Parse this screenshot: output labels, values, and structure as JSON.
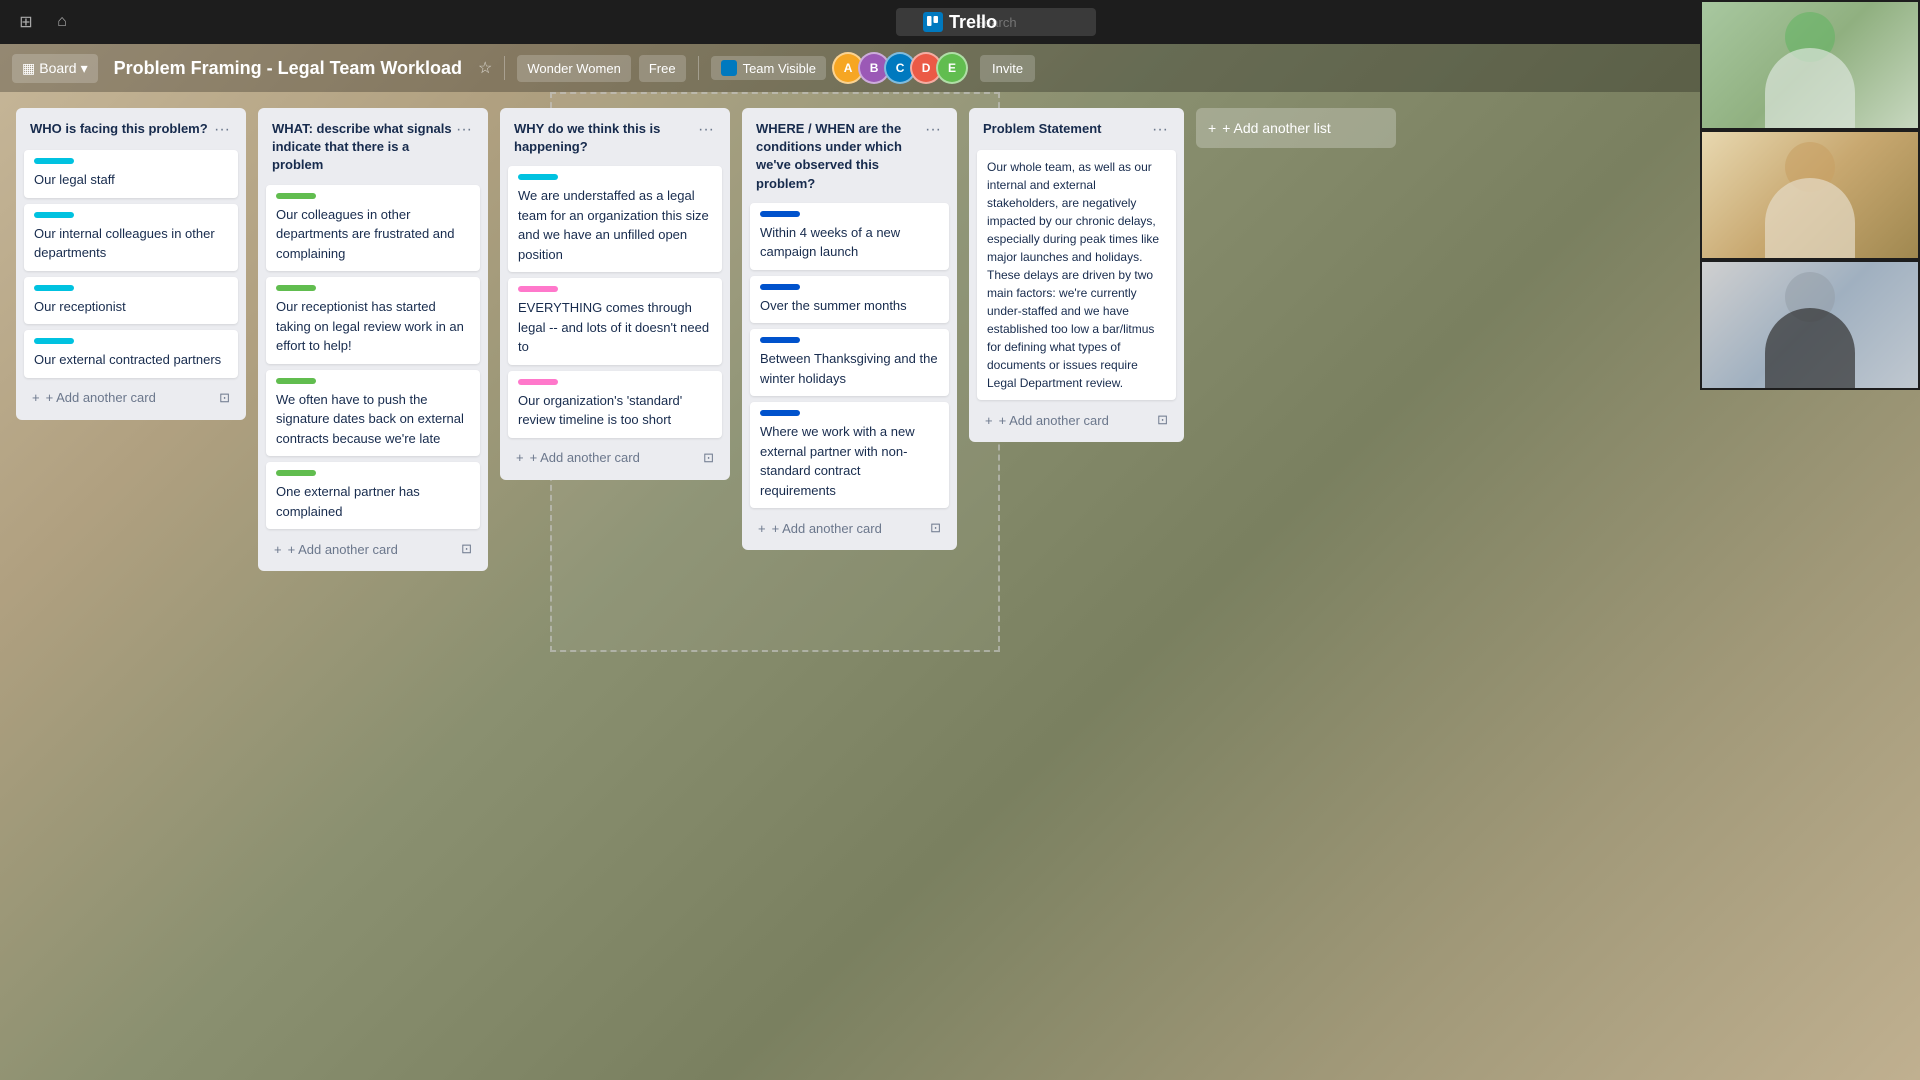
{
  "topbar": {
    "search_placeholder": "Search",
    "logo": "Trello"
  },
  "navbar": {
    "board_label": "Board",
    "title": "Problem Framing - Legal Team Workload",
    "star": "★",
    "pill_wonder": "Wonder Women",
    "pill_free": "Free",
    "team_label": "Team Visible",
    "invite_label": "Invite",
    "avatars": [
      "A",
      "B",
      "C",
      "D",
      "E"
    ]
  },
  "columns": [
    {
      "id": "who",
      "title": "WHO is facing this problem?",
      "cards": [
        {
          "label_color": "cyan",
          "text": "Our legal staff"
        },
        {
          "label_color": "cyan",
          "text": "Our internal colleagues in other departments"
        },
        {
          "label_color": "cyan",
          "text": "Our receptionist"
        },
        {
          "label_color": "cyan",
          "text": "Our external contracted partners"
        }
      ],
      "add_label": "+ Add another card"
    },
    {
      "id": "what",
      "title": "WHAT: describe what signals indicate that there is a problem",
      "cards": [
        {
          "label_color": "green",
          "text": "Our colleagues in other departments are frustrated and complaining"
        },
        {
          "label_color": "green",
          "text": "Our receptionist has started taking on legal review work in an effort to help!"
        },
        {
          "label_color": "green",
          "text": "We often have to push the signature dates back on external contracts because we're late"
        },
        {
          "label_color": "green",
          "text": "One external partner has complained"
        }
      ],
      "add_label": "+ Add another card"
    },
    {
      "id": "why",
      "title": "WHY do we think this is happening?",
      "cards": [
        {
          "label_color": "cyan",
          "text": "We are understaffed as a legal team for an organization this size and we have an unfilled open position"
        },
        {
          "label_color": "pink",
          "text": "EVERYTHING comes through legal -- and lots of it doesn't need to"
        },
        {
          "label_color": "pink",
          "text": "Our organization's 'standard' review timeline is too short"
        }
      ],
      "add_label": "+ Add another card"
    },
    {
      "id": "where",
      "title": "WHERE / WHEN are the conditions under which we've observed this problem?",
      "cards": [
        {
          "label_color": "navy",
          "text": "Within 4 weeks of a new campaign launch"
        },
        {
          "label_color": "navy",
          "text": "Over the summer months"
        },
        {
          "label_color": "navy",
          "text": "Between Thanksgiving and the winter holidays"
        },
        {
          "label_color": "navy",
          "text": "Where we work with a new external partner with non-standard contract requirements"
        }
      ],
      "add_label": "+ Add another card"
    },
    {
      "id": "statement",
      "title": "Problem Statement",
      "cards": [
        {
          "label_color": null,
          "text": "Our whole team, as well as our internal and external stakeholders, are negatively impacted by our chronic delays, especially during peak times like major launches and holidays. These delays are driven by two main factors: we're currently under-staffed and we have established too low a bar/litmus for defining what types of documents or issues require Legal Department review."
        }
      ],
      "add_label": "+ Add another card"
    }
  ],
  "add_list": "+ Add another list",
  "icons": {
    "grid": "⊞",
    "home": "⌂",
    "search": "🔍",
    "chevron": "▾",
    "plus": "+",
    "dots": "···",
    "star": "☆",
    "archive": "⊡",
    "team_icon": "▦"
  }
}
